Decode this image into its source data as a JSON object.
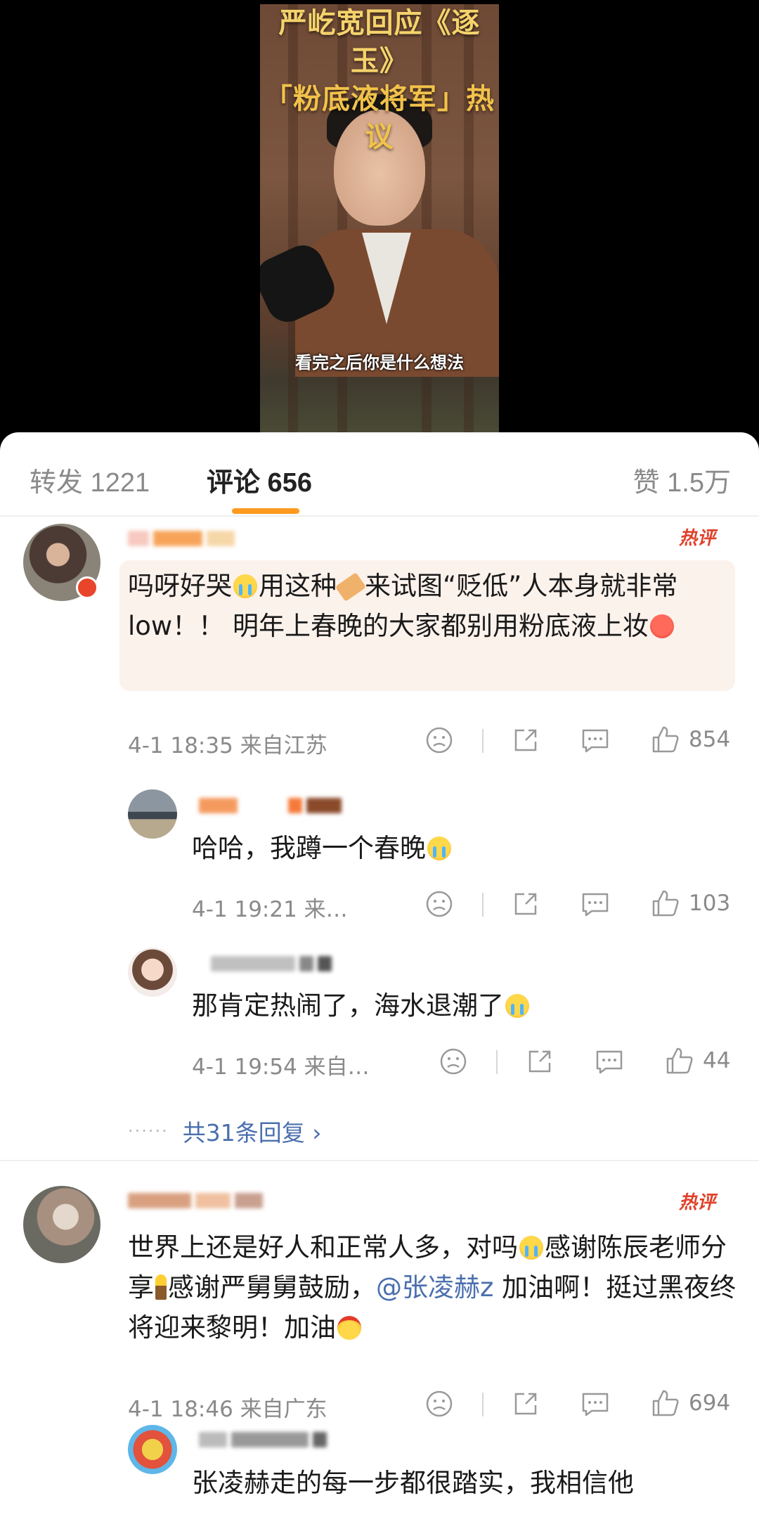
{
  "video": {
    "title_line1": "严屹宽回应《逐玉》",
    "title_line2": "「粉底液将军」热议",
    "subtitle": "看完之后你是什么想法"
  },
  "tabs": {
    "repost": "转发 1221",
    "comments": "评论 656",
    "likes": "赞 1.5万"
  },
  "comments": [
    {
      "badge": "热评",
      "text_parts": [
        "吗呀好哭",
        "用这种",
        "来试图“贬低”人本身就非常low！！ 明年上春晚的大家都别用粉底液上妆"
      ],
      "time": "4-1 18:35 来自江苏",
      "likes": "854",
      "replies": [
        {
          "text": "哈哈，我蹲一个春晚",
          "time": "4-1 19:21 来…",
          "likes": "103"
        },
        {
          "text": "那肯定热闹了，海水退潮了",
          "time": "4-1 19:54 来自…",
          "likes": "44"
        }
      ],
      "reply_more": "共31条回复 ›"
    },
    {
      "badge": "热评",
      "text_parts": [
        "世界上还是好人和正常人多，对吗",
        "感谢陈辰老师分享",
        "感谢严舅舅鼓励，",
        "@张凌赫z",
        " 加油啊！挺过黑夜终将迎来黎明！加油"
      ],
      "time": "4-1 18:46 来自广东",
      "likes": "694",
      "replies": [
        {
          "text": "张凌赫走的每一步都很踏实，我相信他"
        }
      ]
    }
  ],
  "icons": [
    "dislike-icon",
    "share-icon",
    "comment-icon",
    "like-icon",
    "chevron-right-icon"
  ],
  "colors": {
    "accent": "#ff9a1f",
    "hot": "#e0402a",
    "link": "#4a6fae"
  }
}
